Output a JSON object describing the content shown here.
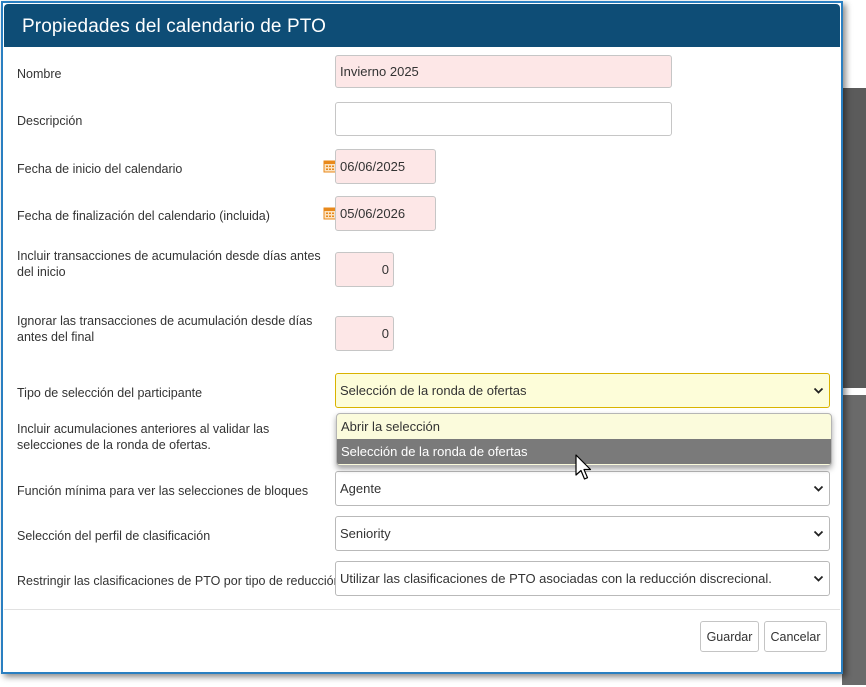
{
  "dialog": {
    "title": "Propiedades del calendario de PTO"
  },
  "fields": {
    "nombre": {
      "label": "Nombre",
      "value": "Invierno 2025"
    },
    "descripcion": {
      "label": "Descripción",
      "value": ""
    },
    "fecha_inicio": {
      "label": "Fecha de inicio del calendario",
      "value": "06/06/2025"
    },
    "fecha_fin": {
      "label": "Fecha de finalización del calendario (incluida)",
      "value": "05/06/2026"
    },
    "incluir_dias": {
      "label": "Incluir transacciones de acumulación desde días antes del inicio",
      "value": "0"
    },
    "ignorar_dias": {
      "label": "Ignorar las transacciones de acumulación desde días antes del final",
      "value": "0"
    },
    "tipo_seleccion": {
      "label": "Tipo de selección del participante",
      "value": "Selección de la ronda de ofertas",
      "options": [
        "Abrir la selección",
        "Selección de la ronda de ofertas"
      ]
    },
    "incluir_acumulaciones": {
      "label": "Incluir acumulaciones anteriores al validar las selecciones de la ronda de ofertas."
    },
    "funcion_minima": {
      "label": "Función mínima para ver las selecciones de bloques",
      "value": "Agente"
    },
    "perfil_clasificacion": {
      "label": "Selección del perfil de clasificación",
      "value": "Seniority"
    },
    "restringir_clasificaciones": {
      "label": "Restringir las clasificaciones de PTO por tipo de reducción",
      "value": "Utilizar las clasificaciones de PTO asociadas con la reducción discrecional."
    }
  },
  "buttons": {
    "save": "Guardar",
    "cancel": "Cancelar"
  },
  "colors": {
    "header": "#0e4d76",
    "required_bg": "#fde7e7",
    "open_select_bg": "#fdfdd9",
    "highlight": "#7a7a7a"
  },
  "icons": {
    "calendar": "calendar-icon",
    "chevron": "chevron-down-icon",
    "cursor": "mouse-pointer-icon"
  }
}
